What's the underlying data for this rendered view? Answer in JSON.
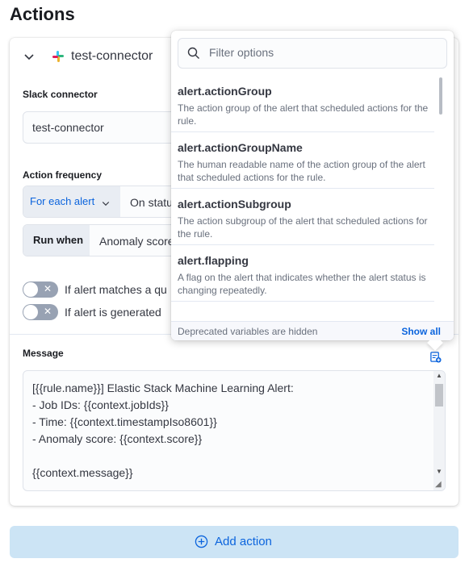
{
  "page": {
    "title": "Actions"
  },
  "connector": {
    "name": "test-connector"
  },
  "form": {
    "slack_label": "Slack connector",
    "slack_value": "test-connector",
    "frequency_label": "Action frequency",
    "frequency_mode": "For each alert",
    "frequency_value": "On statu",
    "run_when_label": "Run when",
    "run_when_value": "Anomaly score",
    "toggle1_label": "If alert matches a qu",
    "toggle2_label": "If alert is generated",
    "message_label": "Message",
    "message_lines": [
      "[{{rule.name}}] Elastic Stack Machine Learning Alert:",
      "- Job IDs: {{context.jobIds}}",
      "- Time: {{context.timestampIso8601}}",
      "- Anomaly score: {{context.score}}",
      "",
      "{{context.message}}"
    ]
  },
  "add_action": {
    "label": "Add action"
  },
  "popover": {
    "filter_placeholder": "Filter options",
    "options": [
      {
        "name": "alert.actionGroup",
        "description": "The action group of the alert that scheduled actions for the rule."
      },
      {
        "name": "alert.actionGroupName",
        "description": "The human readable name of the action group of the alert that scheduled actions for the rule."
      },
      {
        "name": "alert.actionSubgroup",
        "description": "The action subgroup of the alert that scheduled actions for the rule."
      },
      {
        "name": "alert.flapping",
        "description": "A flag on the alert that indicates whether the alert status is changing repeatedly."
      }
    ],
    "footer_note": "Deprecated variables are hidden",
    "show_all": "Show all"
  },
  "colors": {
    "accent": "#0b64dd",
    "button_bg": "#cce4f5"
  }
}
